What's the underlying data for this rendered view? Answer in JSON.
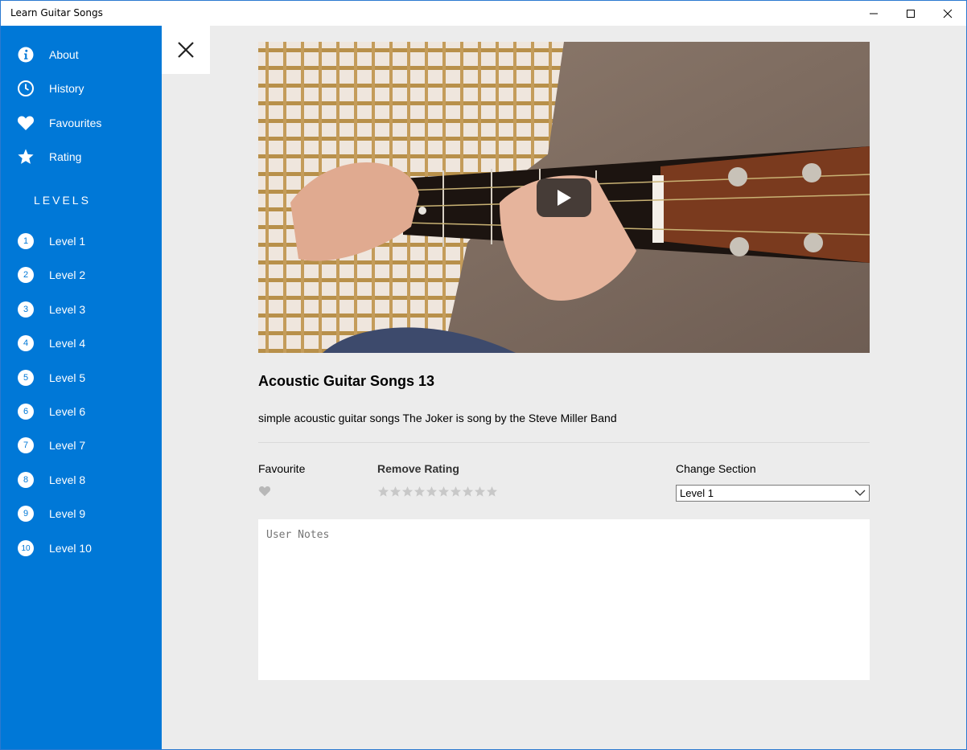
{
  "window": {
    "title": "Learn Guitar Songs"
  },
  "sidebar": {
    "items": [
      {
        "label": "About",
        "icon": "info-icon"
      },
      {
        "label": "History",
        "icon": "clock-icon"
      },
      {
        "label": "Favourites",
        "icon": "heart-icon"
      },
      {
        "label": "Rating",
        "icon": "star-icon"
      }
    ],
    "levels_header": "LEVELS",
    "levels": [
      {
        "num": "1",
        "label": "Level 1"
      },
      {
        "num": "2",
        "label": "Level 2"
      },
      {
        "num": "3",
        "label": "Level 3"
      },
      {
        "num": "4",
        "label": "Level 4"
      },
      {
        "num": "5",
        "label": "Level 5"
      },
      {
        "num": "6",
        "label": "Level 6"
      },
      {
        "num": "7",
        "label": "Level 7"
      },
      {
        "num": "8",
        "label": "Level 8"
      },
      {
        "num": "9",
        "label": "Level 9"
      },
      {
        "num": "10",
        "label": "Level 10"
      }
    ]
  },
  "song": {
    "title": "Acoustic Guitar Songs 13",
    "description": "simple acoustic guitar songs The Joker is song by the Steve Miller Band"
  },
  "controls": {
    "favourite_label": "Favourite",
    "remove_rating_label": "Remove Rating",
    "rating": 0,
    "rating_max": 10,
    "change_section_label": "Change Section",
    "section_selected": "Level 1"
  },
  "notes": {
    "placeholder": "User Notes"
  },
  "colors": {
    "accent": "#0078d7",
    "background": "#ececec",
    "star_empty": "#c8c8c8"
  }
}
